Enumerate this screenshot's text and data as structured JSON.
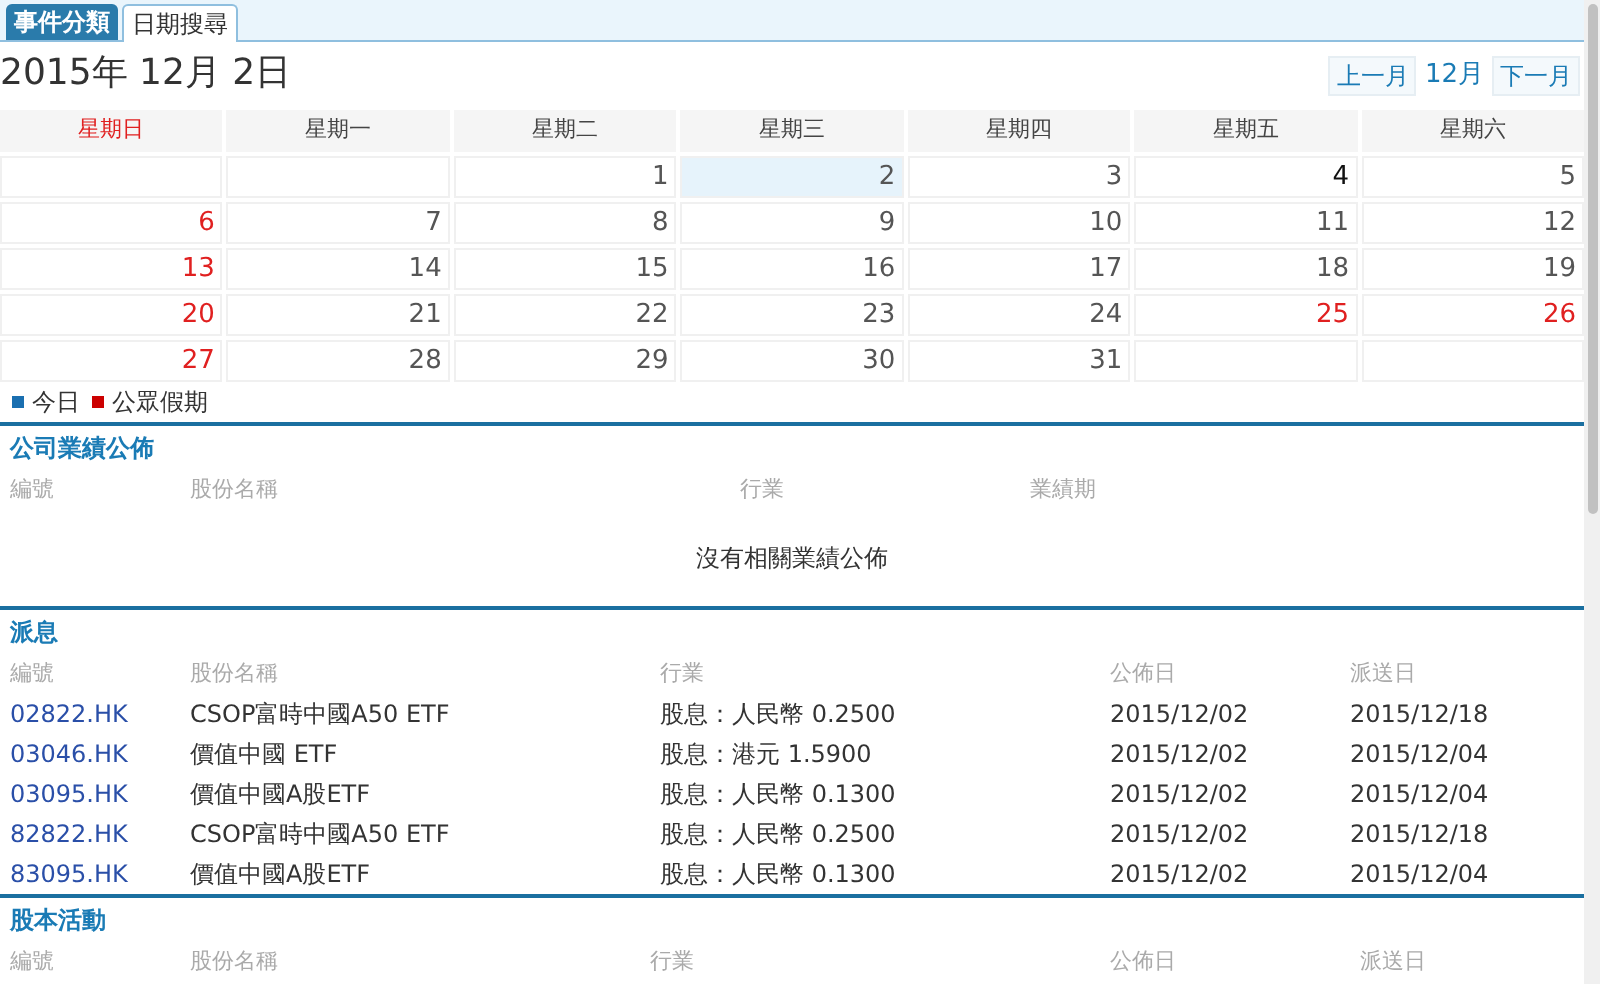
{
  "tabs": [
    {
      "label": "事件分類",
      "selected": false
    },
    {
      "label": "日期搜尋",
      "selected": true
    }
  ],
  "date_title": "2015年 12月 2日",
  "month_nav": {
    "prev": "上一月",
    "current": "12月",
    "next": "下一月"
  },
  "calendar": {
    "weekdays": [
      {
        "label": "星期日",
        "holiday": true
      },
      {
        "label": "星期一",
        "holiday": false
      },
      {
        "label": "星期二",
        "holiday": false
      },
      {
        "label": "星期三",
        "holiday": false
      },
      {
        "label": "星期四",
        "holiday": false
      },
      {
        "label": "星期五",
        "holiday": false
      },
      {
        "label": "星期六",
        "holiday": false
      }
    ],
    "weeks": [
      [
        {
          "kind": "blank"
        },
        {
          "kind": "blank"
        },
        {
          "day": "1",
          "holiday": false,
          "today": false,
          "has_event": false
        },
        {
          "day": "2",
          "holiday": false,
          "today": true,
          "has_event": false
        },
        {
          "day": "3",
          "holiday": false,
          "today": false,
          "has_event": false
        },
        {
          "day": "4",
          "holiday": false,
          "today": false,
          "has_event": true
        },
        {
          "day": "5",
          "holiday": false,
          "today": false,
          "has_event": false
        }
      ],
      [
        {
          "day": "6",
          "holiday": true,
          "today": false,
          "has_event": false
        },
        {
          "day": "7",
          "holiday": false,
          "today": false,
          "has_event": false
        },
        {
          "day": "8",
          "holiday": false,
          "today": false,
          "has_event": false
        },
        {
          "day": "9",
          "holiday": false,
          "today": false,
          "has_event": false
        },
        {
          "day": "10",
          "holiday": false,
          "today": false,
          "has_event": false
        },
        {
          "day": "11",
          "holiday": false,
          "today": false,
          "has_event": false
        },
        {
          "day": "12",
          "holiday": false,
          "today": false,
          "has_event": false
        }
      ],
      [
        {
          "day": "13",
          "holiday": true,
          "today": false,
          "has_event": false
        },
        {
          "day": "14",
          "holiday": false,
          "today": false,
          "has_event": false
        },
        {
          "day": "15",
          "holiday": false,
          "today": false,
          "has_event": false
        },
        {
          "day": "16",
          "holiday": false,
          "today": false,
          "has_event": false
        },
        {
          "day": "17",
          "holiday": false,
          "today": false,
          "has_event": false
        },
        {
          "day": "18",
          "holiday": false,
          "today": false,
          "has_event": false
        },
        {
          "day": "19",
          "holiday": false,
          "today": false,
          "has_event": false
        }
      ],
      [
        {
          "day": "20",
          "holiday": true,
          "today": false,
          "has_event": false
        },
        {
          "day": "21",
          "holiday": false,
          "today": false,
          "has_event": false
        },
        {
          "day": "22",
          "holiday": false,
          "today": false,
          "has_event": false
        },
        {
          "day": "23",
          "holiday": false,
          "today": false,
          "has_event": false
        },
        {
          "day": "24",
          "holiday": false,
          "today": false,
          "has_event": false
        },
        {
          "day": "25",
          "holiday": true,
          "today": false,
          "has_event": false
        },
        {
          "day": "26",
          "holiday": true,
          "today": false,
          "has_event": false
        }
      ],
      [
        {
          "day": "27",
          "holiday": true,
          "today": false,
          "has_event": false
        },
        {
          "day": "28",
          "holiday": false,
          "today": false,
          "has_event": false
        },
        {
          "day": "29",
          "holiday": false,
          "today": false,
          "has_event": false
        },
        {
          "day": "30",
          "holiday": false,
          "today": false,
          "has_event": false
        },
        {
          "day": "31",
          "holiday": false,
          "today": false,
          "has_event": false
        },
        {
          "kind": "blank"
        },
        {
          "kind": "blank"
        }
      ]
    ]
  },
  "legend": [
    {
      "label": "今日",
      "color": "#1a6fb0"
    },
    {
      "label": "公眾假期",
      "color": "#cc0000"
    }
  ],
  "sections": [
    {
      "kind": "results",
      "title": "公司業績公佈",
      "columns": [
        "編號",
        "股份名稱",
        "行業",
        "業績期"
      ],
      "empty_message": "沒有相關業績公佈"
    },
    {
      "kind": "dividend",
      "title": "派息",
      "columns": [
        "編號",
        "股份名稱",
        "行業",
        "公佈日",
        "派送日"
      ],
      "rows": [
        [
          "02822.HK",
          "CSOP富時中國A50 ETF",
          "股息：人民幣 0.2500",
          "2015/12/02",
          "2015/12/18"
        ],
        [
          "03046.HK",
          "價值中國 ETF",
          "股息：港元 1.5900",
          "2015/12/02",
          "2015/12/04"
        ],
        [
          "03095.HK",
          "價值中國A股ETF",
          "股息：人民幣 0.1300",
          "2015/12/02",
          "2015/12/04"
        ],
        [
          "82822.HK",
          "CSOP富時中國A50 ETF",
          "股息：人民幣 0.2500",
          "2015/12/02",
          "2015/12/18"
        ],
        [
          "83095.HK",
          "價值中國A股ETF",
          "股息：人民幣 0.1300",
          "2015/12/02",
          "2015/12/04"
        ]
      ]
    },
    {
      "kind": "capital",
      "title": "股本活動",
      "columns": [
        "編號",
        "股份名稱",
        "行業",
        "公佈日",
        "派送日"
      ]
    }
  ]
}
